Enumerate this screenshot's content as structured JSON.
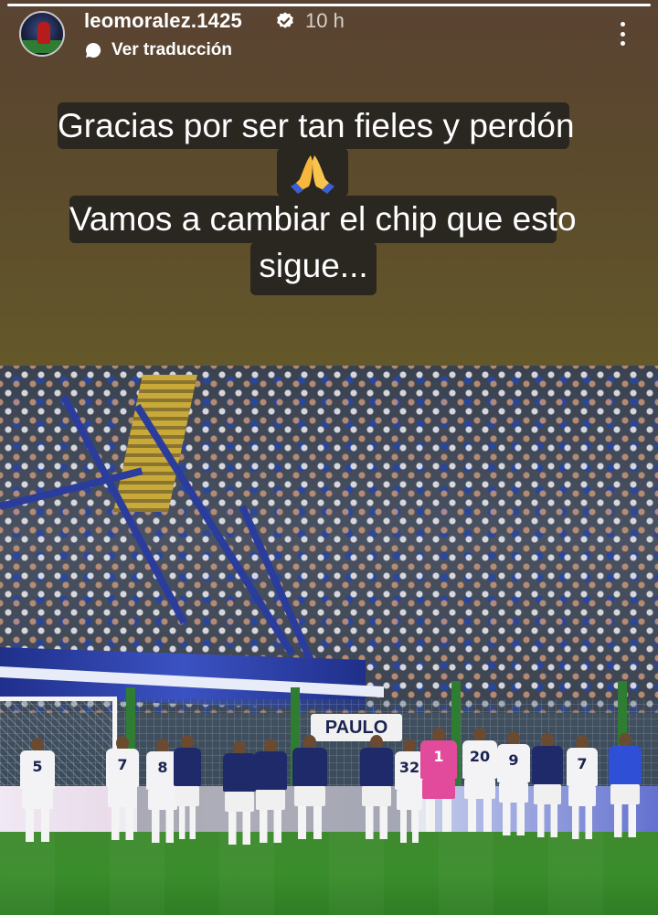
{
  "story": {
    "progress_percent": 100,
    "username": "leomoralez.1425",
    "verified": true,
    "timestamp": "10 h",
    "translate_label": "Ver traducción"
  },
  "caption": {
    "line1": "Gracias  por ser tan fieles y perdón",
    "emoji": "folded-hands-emoji",
    "line2": "Vamos a cambiar el chip que esto",
    "line3": "sigue..."
  },
  "photo": {
    "board_text": "PAULO",
    "jersey_numbers": [
      "5",
      "7",
      "8",
      "",
      "",
      "",
      "",
      "",
      "32",
      "1",
      "20",
      "9",
      "",
      "7",
      ""
    ]
  },
  "colors": {
    "background": "#5a4a2c",
    "caption_bg": "#2a2620",
    "text": "#ffffff"
  }
}
